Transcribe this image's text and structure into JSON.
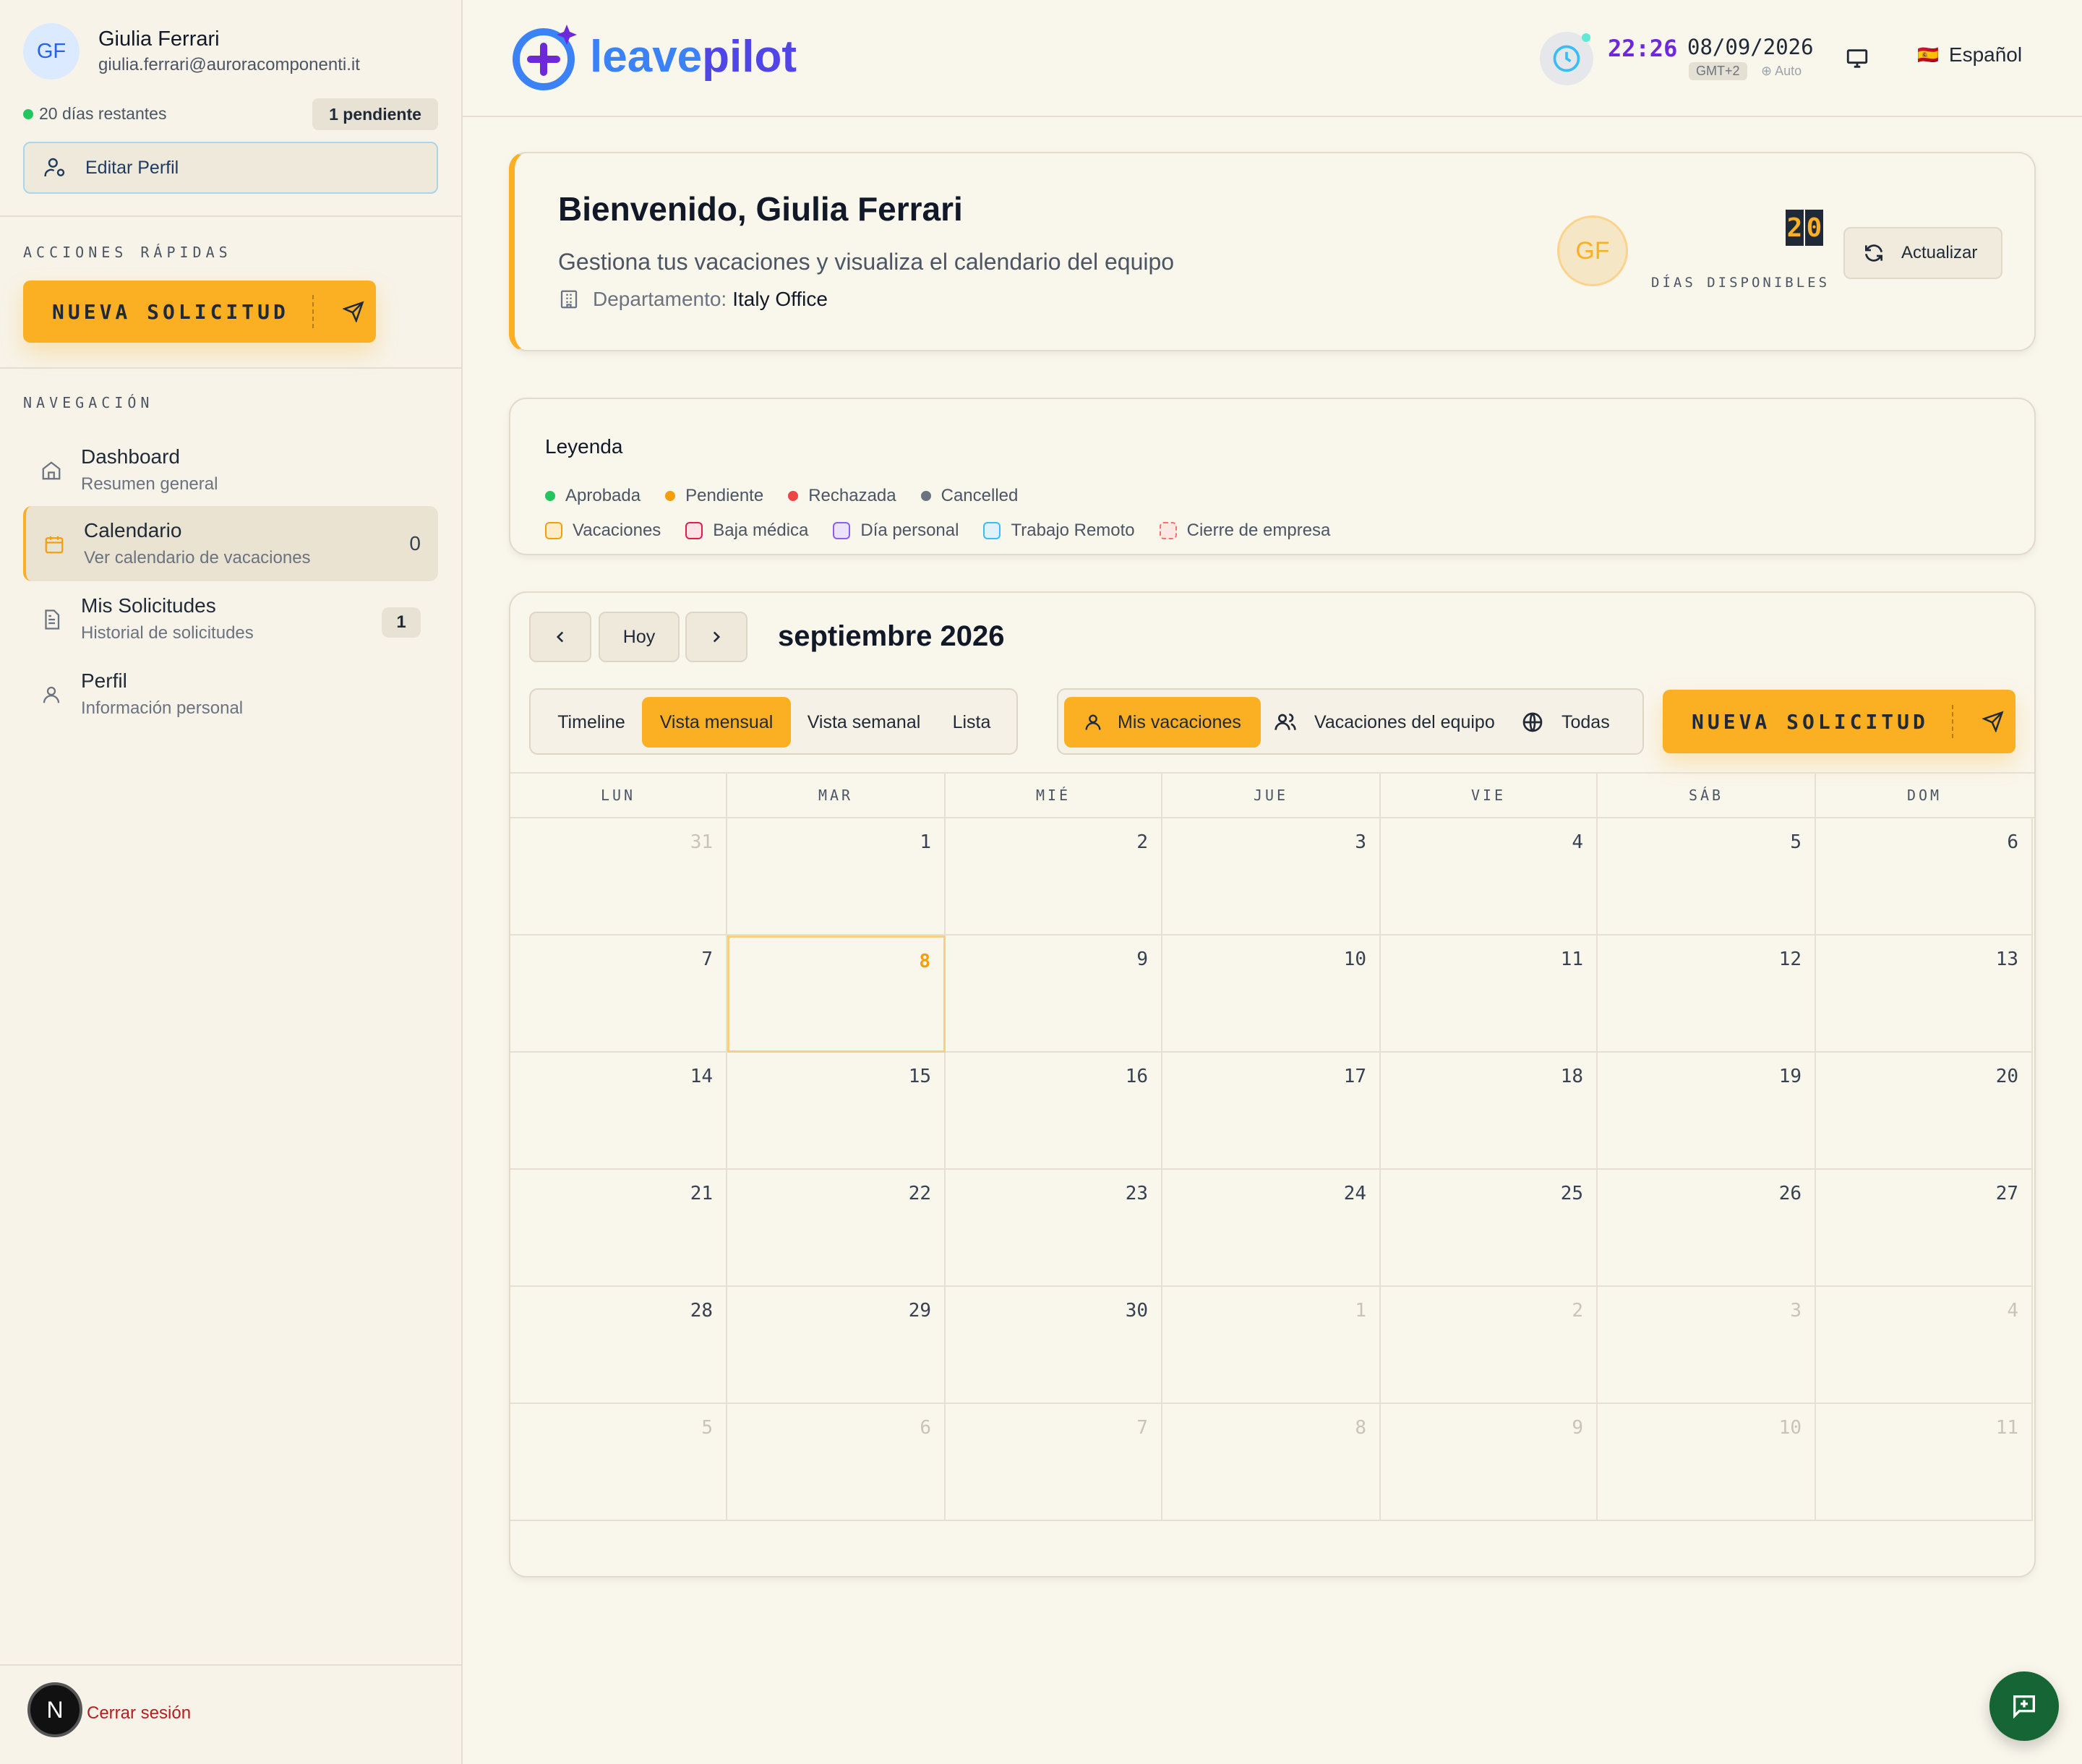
{
  "user": {
    "initials": "GF",
    "name": "Giulia Ferrari",
    "email": "giulia.ferrari@auroracomponenti.it"
  },
  "sidebar": {
    "days_remaining": "20 días restantes",
    "pending_badge": "1 pendiente",
    "edit_profile": "Editar Perfil",
    "quick_actions_label": "ACCIONES RÁPIDAS",
    "new_request": "NUEVA SOLICITUD",
    "nav_label": "NAVEGACIÓN",
    "items": [
      {
        "title": "Dashboard",
        "subtitle": "Resumen general",
        "badge": ""
      },
      {
        "title": "Calendario",
        "subtitle": "Ver calendario de vacaciones",
        "badge": "0"
      },
      {
        "title": "Mis Solicitudes",
        "subtitle": "Historial de solicitudes",
        "badge": "1"
      },
      {
        "title": "Perfil",
        "subtitle": "Información personal",
        "badge": ""
      }
    ],
    "logout_avatar": "N",
    "logout": "Cerrar sesión"
  },
  "header": {
    "logo_a": "leave",
    "logo_b": "pilot",
    "time": "22:26",
    "date": "08/09/2026",
    "timezone": "GMT+2",
    "tz_mode": "⊕ Auto",
    "language_flag": "🇪🇸",
    "language": "Español"
  },
  "welcome": {
    "title": "Bienvenido, Giulia Ferrari",
    "subtitle": "Gestiona tus vacaciones y visualiza el calendario del equipo",
    "dept_label": "Departamento:",
    "dept_value": "Italy Office",
    "avatar": "GF",
    "days_digit_1": "2",
    "days_digit_2": "0",
    "days_label": "DÍAS DISPONIBLES",
    "refresh": "Actualizar"
  },
  "legend": {
    "title": "Leyenda",
    "statuses": [
      {
        "label": "Aprobada",
        "color": "#22c55e"
      },
      {
        "label": "Pendiente",
        "color": "#f59e0b"
      },
      {
        "label": "Rechazada",
        "color": "#ef4444"
      },
      {
        "label": "Cancelled",
        "color": "#6b7280"
      }
    ],
    "types": [
      {
        "label": "Vacaciones",
        "color": "#f59e0b",
        "bg": "#fdecc5"
      },
      {
        "label": "Baja médica",
        "color": "#e11d48",
        "bg": "#fde2e6"
      },
      {
        "label": "Día personal",
        "color": "#8b5cf6",
        "bg": "#ebe3fb"
      },
      {
        "label": "Trabajo Remoto",
        "color": "#38bdf8",
        "bg": "#dff2fb"
      },
      {
        "label": "Cierre de empresa",
        "color": "#f87171",
        "bg": "#fde7e2"
      }
    ]
  },
  "calendar": {
    "today_btn": "Hoy",
    "month_title": "septiembre 2026",
    "views": [
      "Timeline",
      "Vista mensual",
      "Vista semanal",
      "Lista"
    ],
    "filters": [
      "Mis vacaciones",
      "Vacaciones del equipo",
      "Todas"
    ],
    "new_request": "NUEVA SOLICITUD",
    "weekdays": [
      "LUN",
      "MAR",
      "MIÉ",
      "JUE",
      "VIE",
      "SÁB",
      "DOM"
    ],
    "weeks": [
      [
        "31",
        "1",
        "2",
        "3",
        "4",
        "5",
        "6"
      ],
      [
        "7",
        "8",
        "9",
        "10",
        "11",
        "12",
        "13"
      ],
      [
        "14",
        "15",
        "16",
        "17",
        "18",
        "19",
        "20"
      ],
      [
        "21",
        "22",
        "23",
        "24",
        "25",
        "26",
        "27"
      ],
      [
        "28",
        "29",
        "30",
        "1",
        "2",
        "3",
        "4"
      ],
      [
        "5",
        "6",
        "7",
        "8",
        "9",
        "10",
        "11"
      ]
    ]
  },
  "colors": {
    "accent": "#fbb024",
    "brand_blue": "#2563eb",
    "brand_purple": "#6d28d9",
    "fab": "#166534"
  }
}
